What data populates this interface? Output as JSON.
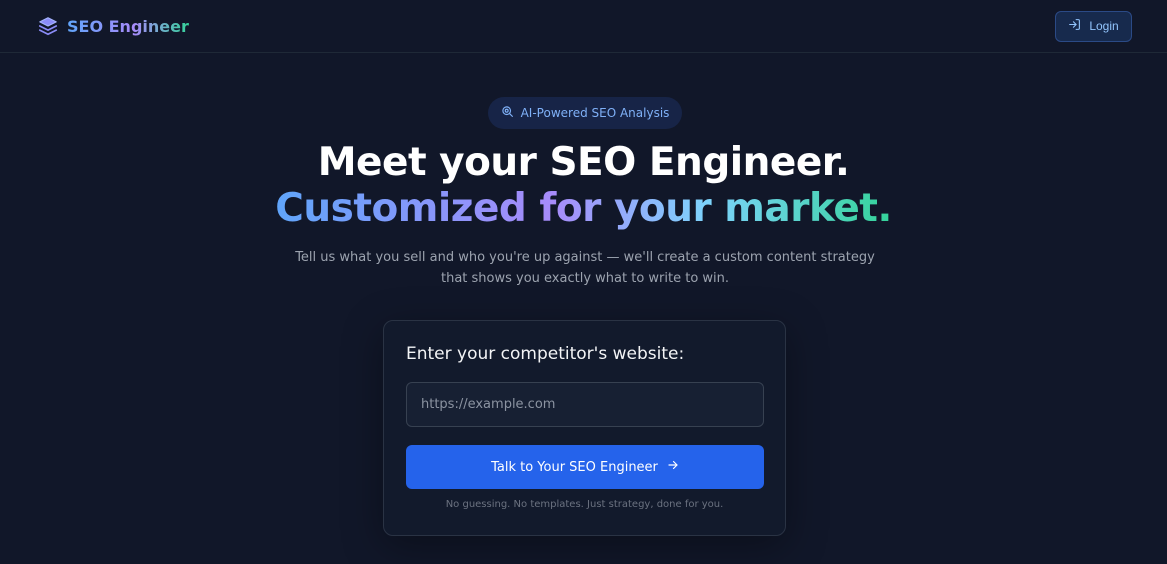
{
  "header": {
    "brand_name": "SEO Engineer",
    "brand_icon": "layers-icon",
    "login_label": "Login",
    "login_icon": "log-in-icon"
  },
  "hero": {
    "badge_label": "AI-Powered SEO Analysis",
    "badge_icon": "zoom-search-icon",
    "headline_line1": "Meet your SEO Engineer.",
    "headline_line2": "Customized for your market.",
    "subtitle": "Tell us what you sell and who you're up against — we'll create a custom content strategy that shows you exactly what to write to win."
  },
  "form": {
    "title": "Enter your competitor's website:",
    "url_placeholder": "https://example.com",
    "url_value": "",
    "submit_label": "Talk to Your SEO Engineer",
    "submit_icon": "arrow-right-icon",
    "footnote": "No guessing. No templates. Just strategy, done for you."
  },
  "colors": {
    "background": "#111729",
    "accent": "#2563eb",
    "gradient": [
      "#60a5fa",
      "#a78bfa",
      "#34d399"
    ]
  }
}
